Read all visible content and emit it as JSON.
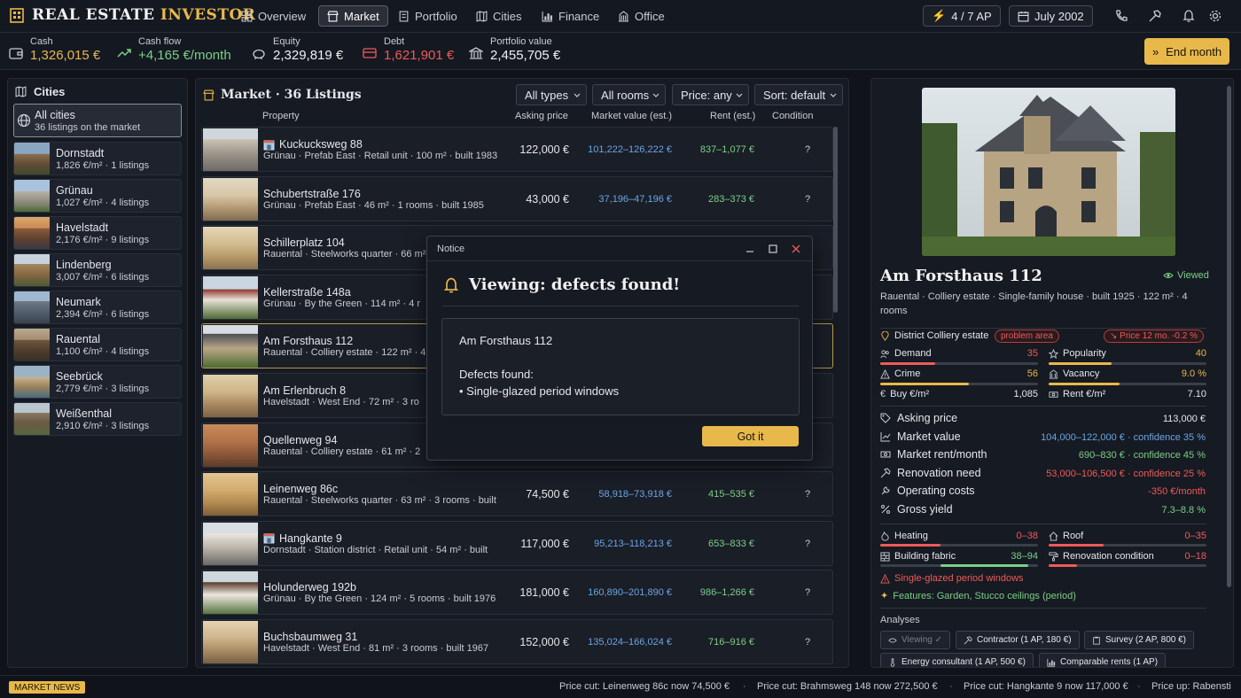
{
  "app": {
    "brand_left": "REAL ESTATE",
    "brand_right": "INVESTOR"
  },
  "nav": {
    "tabs": [
      {
        "label": "Overview",
        "icon": "grid-icon"
      },
      {
        "label": "Market",
        "icon": "store-icon",
        "active": true
      },
      {
        "label": "Portfolio",
        "icon": "document-icon"
      },
      {
        "label": "Cities",
        "icon": "map-icon"
      },
      {
        "label": "Finance",
        "icon": "chart-icon"
      },
      {
        "label": "Office",
        "icon": "building-icon"
      }
    ],
    "action_points": "4 / 7 AP",
    "date": "July 2002"
  },
  "stats": {
    "cash": {
      "label": "Cash",
      "value": "1,326,015 €"
    },
    "cash_flow": {
      "label": "Cash flow",
      "value": "+4,165 €/month"
    },
    "equity": {
      "label": "Equity",
      "value": "2,329,819 €"
    },
    "debt": {
      "label": "Debt",
      "value": "1,621,901 €"
    },
    "portfolio_value": {
      "label": "Portfolio value",
      "value": "2,455,705 €"
    },
    "end_month": "End month"
  },
  "cities": {
    "title": "Cities",
    "all": {
      "name": "All cities",
      "info": "36 listings on the market"
    },
    "items": [
      {
        "name": "Dornstadt",
        "info": "1,826 €/m²  ·  1 listings"
      },
      {
        "name": "Grünau",
        "info": "1,027 €/m²  ·  4 listings"
      },
      {
        "name": "Havelstadt",
        "info": "2,176 €/m²  ·  9 listings"
      },
      {
        "name": "Lindenberg",
        "info": "3,007 €/m²  ·  6 listings"
      },
      {
        "name": "Neumark",
        "info": "2,394 €/m²  ·  6 listings"
      },
      {
        "name": "Rauental",
        "info": "1,100 €/m²  ·  4 listings"
      },
      {
        "name": "Seebrück",
        "info": "2,779 €/m²  ·  3 listings"
      },
      {
        "name": "Weißenthal",
        "info": "2,910 €/m²  ·  3 listings"
      }
    ]
  },
  "market": {
    "title": "Market · 36 Listings",
    "filters": {
      "type": "All types",
      "rooms": "All rooms",
      "price": "Price: any",
      "sort": "Sort: default"
    },
    "columns": {
      "property": "Property",
      "asking": "Asking price",
      "market_value": "Market value (est.)",
      "rent": "Rent (est.)",
      "condition": "Condition"
    },
    "rows": [
      {
        "name": "Kuckucksweg 88",
        "commercial": true,
        "info": "Grünau · Prefab East  ·  Retail unit  ·  100 m²  ·  built 1983",
        "price": "122,000 €",
        "mv": "101,222–126,222 €",
        "rent": "837–1,077 €",
        "cond": "?"
      },
      {
        "name": "Schubertstraße 176",
        "info": "Grünau · Prefab East  ·  46 m²  ·  1 rooms  ·  built 1985",
        "price": "43,000 €",
        "mv": "37,196–47,196 €",
        "rent": "283–373 €",
        "cond": "?"
      },
      {
        "name": "Schillerplatz 104",
        "info": "Rauental · Steelworks quarter  ·  66 m²",
        "price": "",
        "mv": "",
        "rent": "",
        "cond": ""
      },
      {
        "name": "Kellerstraße 148a",
        "info": "Grünau · By the Green  ·  114 m²  ·  4 r",
        "price": "",
        "mv": "",
        "rent": "",
        "cond": ""
      },
      {
        "name": "Am Forsthaus 112",
        "info": "Rauental · Colliery estate  ·  122 m²  ·  4",
        "price": "",
        "mv": "",
        "rent": "",
        "cond": "",
        "selected": true
      },
      {
        "name": "Am Erlenbruch 8",
        "info": "Havelstadt · West End  ·  72 m²  ·  3 ro",
        "price": "",
        "mv": "",
        "rent": "",
        "cond": ""
      },
      {
        "name": "Quellenweg 94",
        "info": "Rauental · Colliery estate  ·  61 m²  ·  2",
        "price": "",
        "mv": "",
        "rent": "",
        "cond": ""
      },
      {
        "name": "Leinenweg 86c",
        "info": "Rauental · Steelworks quarter  ·  63 m²  ·  3 rooms  ·  built",
        "price": "74,500 €",
        "mv": "58,918–73,918 €",
        "rent": "415–535 €",
        "cond": "?"
      },
      {
        "name": "Hangkante 9",
        "commercial": true,
        "info": "Dornstadt · Station district  ·  Retail unit  ·  54 m²  ·  built",
        "price": "117,000 €",
        "mv": "95,213–118,213 €",
        "rent": "653–833 €",
        "cond": "?"
      },
      {
        "name": "Holunderweg 192b",
        "info": "Grünau · By the Green  ·  124 m²  ·  5 rooms  ·  built 1976",
        "price": "181,000 €",
        "mv": "160,890–201,890 €",
        "rent": "986–1,266 €",
        "cond": "?"
      },
      {
        "name": "Buchsbaumweg 31",
        "info": "Havelstadt · West End  ·  81 m²  ·  3 rooms  ·  built 1967",
        "price": "152,000 €",
        "mv": "135,024–166,024 €",
        "rent": "716–916 €",
        "cond": "?"
      }
    ]
  },
  "detail": {
    "title": "Am Forsthaus 112",
    "viewed": "Viewed",
    "subtitle": "Rauental · Colliery estate  ·  Single-family house  ·  built 1925  ·  122 m²  ·  4 rooms",
    "district": "District Colliery estate",
    "problem_badge": "problem area",
    "price_trend": "Price 12 mo. -0.2 %",
    "metrics": {
      "demand": {
        "label": "Demand",
        "value": "35",
        "level": 0.35
      },
      "popularity": {
        "label": "Popularity",
        "value": "40",
        "level": 0.4
      },
      "crime": {
        "label": "Crime",
        "value": "56",
        "level": 0.56
      },
      "vacancy": {
        "label": "Vacancy",
        "value": "9.0 %",
        "level": 0.45
      },
      "buy_sqm": {
        "label": "Buy €/m²",
        "value": "1,085"
      },
      "rent_sqm": {
        "label": "Rent €/m²",
        "value": "7.10"
      }
    },
    "financials": [
      {
        "label": "Asking price",
        "value": "113,000 €",
        "color": "#e5e7eb",
        "icon": "tag-icon"
      },
      {
        "label": "Market value",
        "value": "104,000–122,000 € · confidence 35 %",
        "color": "#6aa5e6",
        "icon": "chart-icon"
      },
      {
        "label": "Market rent/month",
        "value": "690–830 € · confidence 45 %",
        "color": "#7ccf86",
        "icon": "cash-icon"
      },
      {
        "label": "Renovation need",
        "value": "53,000–106,500 € · confidence 25 %",
        "color": "#ef5a5a",
        "icon": "hammer-icon"
      },
      {
        "label": "Operating costs",
        "value": "-350 €/month",
        "color": "#ef5a5a",
        "icon": "wrench-icon"
      },
      {
        "label": "Gross yield",
        "value": "7.3–8.8 %",
        "color": "#7ccf86",
        "icon": "percent-icon"
      }
    ],
    "condition": {
      "heating": {
        "label": "Heating",
        "value": "0–38",
        "level": 0.38
      },
      "roof": {
        "label": "Roof",
        "value": "0–35",
        "level": 0.35
      },
      "fabric": {
        "label": "Building fabric",
        "value": "38–94",
        "from": 0.38,
        "to": 0.94
      },
      "renovation": {
        "label": "Renovation condition",
        "value": "0–18",
        "level": 0.18
      }
    },
    "defect_line": "Single-glazed period windows",
    "features_line": "Features: Garden, Stucco ceilings (period)",
    "analyses_label": "Analyses",
    "analyses": {
      "viewing": "Viewing ✓",
      "contractor": "Contractor (1 AP, 180 €)",
      "survey": "Survey (2 AP, 800 €)",
      "energy": "Energy consultant (1 AP, 500 €)",
      "rents": "Comparable rents (1 AP)"
    }
  },
  "modal": {
    "header": "Notice",
    "title": "Viewing: defects found!",
    "property": "Am Forsthaus 112",
    "defects_label": "Defects found:",
    "defect_item": "• Single-glazed period windows",
    "button": "Got it"
  },
  "ticker": {
    "badge": "MARKET NEWS",
    "items": [
      "Price cut: Leinenweg 86c now 74,500 €",
      "Price cut: Brahmsweg 148 now 272,500 €",
      "Price cut: Hangkante 9 now 117,000 €",
      "Price up: Rabensti"
    ]
  },
  "colors": {
    "accent": "#e8b84b",
    "positive": "#7ccf86",
    "negative": "#ef5a5a",
    "info": "#6aa5e6"
  }
}
